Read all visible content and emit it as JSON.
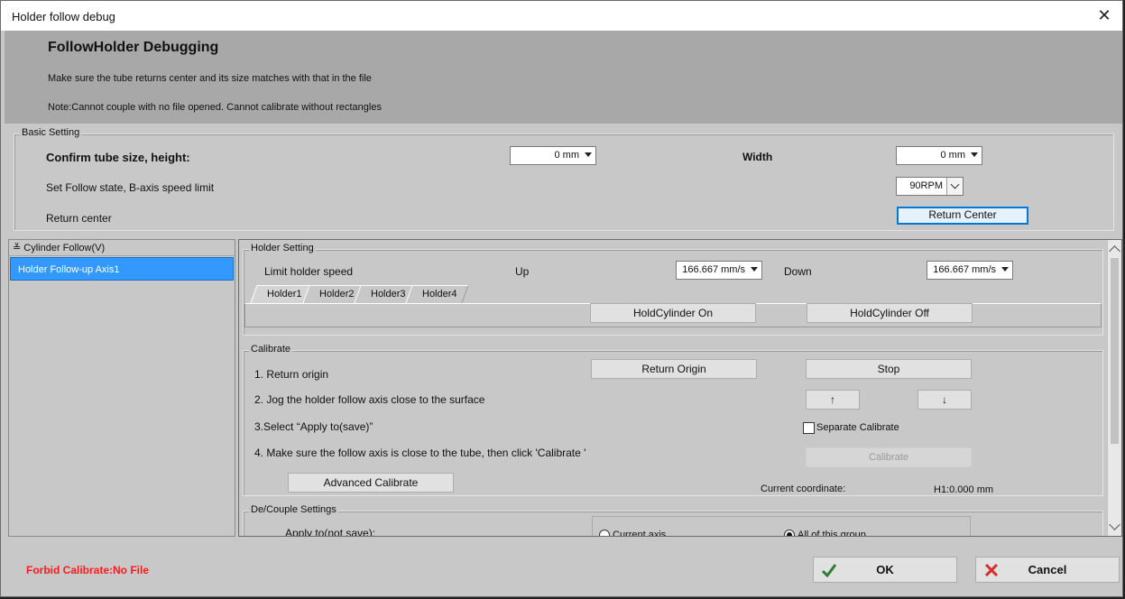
{
  "window": {
    "title": "Holder follow debug"
  },
  "header": {
    "title": "FollowHolder Debugging",
    "line1": "Make sure the tube returns center and its size matches with that in the file",
    "line2": "Note:Cannot couple with no file opened. Cannot calibrate without rectangles"
  },
  "basic": {
    "group_label": "Basic Setting",
    "tube_size_label": "Confirm tube size, height:",
    "height_value": "0 mm",
    "width_label": "Width",
    "width_value": "0 mm",
    "follow_state_label": "Set Follow state, B-axis speed limit",
    "speed_limit_value": "90RPM",
    "return_center_label": "Return center",
    "return_center_button": "Return Center"
  },
  "tree": {
    "group": "Cylinder Follow(V)",
    "selected_item": "Holder Follow-up Axis1"
  },
  "holder": {
    "group_label": "Holder Setting",
    "limit_speed_label": "Limit holder speed",
    "up_label": "Up",
    "up_value": "166.667 mm/s",
    "down_label": "Down",
    "down_value": "166.667 mm/s",
    "tabs": [
      "Holder1",
      "Holder2",
      "Holder3",
      "Holder4"
    ],
    "hold_on_button": "HoldCylinder On",
    "hold_off_button": "HoldCylinder Off"
  },
  "calibrate": {
    "group_label": "Calibrate",
    "step1": "1. Return origin",
    "step2": "2. Jog the holder follow axis close to the surface",
    "step3": "3.Select “Apply to(save)”",
    "step4": "4. Make sure the follow axis is close to the tube, then click 'Calibrate '",
    "return_origin_button": "Return Origin",
    "stop_button": "Stop",
    "up_arrow": "↑",
    "down_arrow": "↓",
    "separate_label": "Separate Calibrate",
    "calibrate_button": "Calibrate",
    "advanced_button": "Advanced Calibrate",
    "coord_label": "Current coordinate:",
    "coord_value": "H1:0.000 mm"
  },
  "couple": {
    "group_label": "De/Couple Settings",
    "apply_label": "Apply to(not save):",
    "radio_current": "Current axis",
    "radio_all": "All of this group"
  },
  "footer": {
    "warning": "Forbid Calibrate:No File",
    "ok": "OK",
    "cancel": "Cancel"
  },
  "colors": {
    "warning": "#ff1a1a",
    "selection": "#3399ff",
    "ok_check": "#2e7d32",
    "cancel_x": "#d32f2f"
  }
}
